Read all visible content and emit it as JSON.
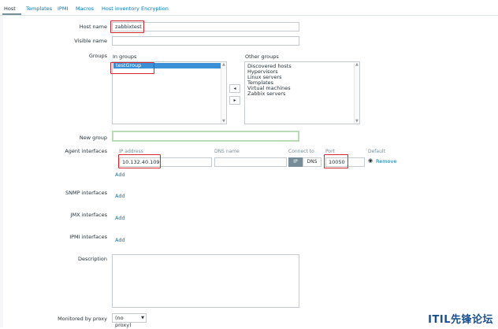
{
  "tabs": [
    "Host",
    "Templates",
    "IPMI",
    "Macros",
    "Host inventory",
    "Encryption"
  ],
  "host_name": {
    "label": "Host name",
    "value": "zabbixtest"
  },
  "visible_name": {
    "label": "Visible name",
    "value": ""
  },
  "groups": {
    "label": "Groups",
    "in_groups_label": "In groups",
    "in_groups": [
      "testGroup"
    ],
    "other_groups_label": "Other groups",
    "other_groups": [
      "Discovered hosts",
      "Hypervisors",
      "Linux servers",
      "Templates",
      "Virtual machines",
      "Zabbix servers"
    ],
    "move_left": "◂",
    "move_right": "▸"
  },
  "new_group": {
    "label": "New group",
    "value": ""
  },
  "agent_interfaces": {
    "label": "Agent interfaces",
    "col_ip": "IP address",
    "col_dns": "DNS name",
    "col_connect": "Connect to",
    "col_port": "Port",
    "col_default": "Default",
    "ip": "10.132.40.109",
    "dns": "",
    "connect_ip": "IP",
    "connect_dns": "DNS",
    "port": "10050",
    "remove": "Remove",
    "add": "Add"
  },
  "snmp": {
    "label": "SNMP interfaces",
    "add": "Add"
  },
  "jmx": {
    "label": "JMX interfaces",
    "add": "Add"
  },
  "ipmi": {
    "label": "IPMI interfaces",
    "add": "Add"
  },
  "description": {
    "label": "Description",
    "value": ""
  },
  "proxy": {
    "label": "Monitored by proxy",
    "value": "(no proxy)"
  },
  "watermark": "ITIL先锋论坛"
}
